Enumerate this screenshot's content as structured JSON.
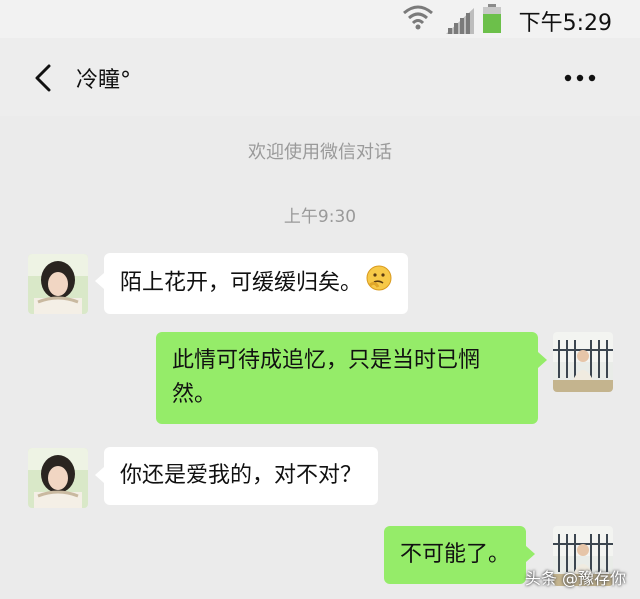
{
  "status_bar": {
    "time": "下午5:29",
    "icons": [
      "wifi-icon",
      "signal-icon",
      "battery-icon"
    ],
    "battery_color": "#6cc04a"
  },
  "header": {
    "title": "冷瞳°",
    "back_icon": "chevron-left-icon",
    "more_icon": "more-dots-icon"
  },
  "system": {
    "welcome": "欢迎使用微信对话",
    "time_divider": "上午9:30"
  },
  "messages": [
    {
      "sender": "other",
      "text": "陌上花开，可缓缓归矣。",
      "emoji": "thinking-face"
    },
    {
      "sender": "me",
      "text": "此情可待成追忆，只是当时已惘然。"
    },
    {
      "sender": "other",
      "text": "你还是爱我的，对不对？"
    },
    {
      "sender": "me",
      "text": "不可能了。"
    }
  ],
  "colors": {
    "sent_bubble": "#95ec69",
    "received_bubble": "#ffffff",
    "background": "#ebebeb"
  },
  "watermark": "头条 @豫存你"
}
